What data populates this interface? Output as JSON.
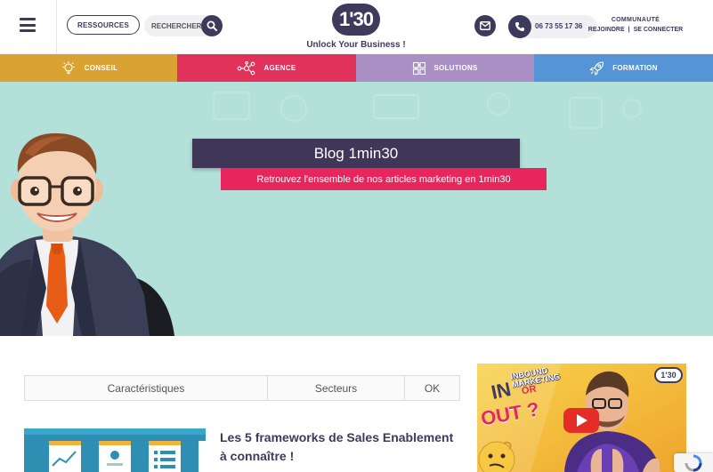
{
  "header": {
    "menu_icon": "hamburger-icon",
    "ressources_label": "RESSOURCES",
    "search_placeholder": "RECHERCHER",
    "search_icon": "magnifier-icon",
    "logo_text": "1'30",
    "logo_tagline": "Unlock Your Business !",
    "mail_icon": "envelope-icon",
    "phone_icon": "phone-icon",
    "phone_number": "06 73 55 17 36",
    "community_title": "COMMUNAUTÉ",
    "join_label": "REJOINDRE",
    "separator": "|",
    "login_label": "SE CONNECTER"
  },
  "nav": {
    "items": [
      {
        "label": "CONSEIL",
        "icon": "lightbulb-icon",
        "color": "#d9a233"
      },
      {
        "label": "AGENCE",
        "icon": "network-icon",
        "color": "#e0325a"
      },
      {
        "label": "SOLUTIONS",
        "icon": "puzzle-icon",
        "color": "#a98fc4"
      },
      {
        "label": "FORMATION",
        "icon": "rocket-icon",
        "color": "#5595d6"
      }
    ]
  },
  "hero": {
    "title": "Blog 1min30",
    "subtitle": "Retrouvez l'ensemble de nos articles marketing en 1min30",
    "background": "#b3e0d9"
  },
  "filters": {
    "items": [
      "Caractéristiques",
      "Secteurs",
      "OK"
    ]
  },
  "article": {
    "title_line1": "Les 5 frameworks de Sales Enablement",
    "title_line2": "à connaître !"
  },
  "video": {
    "badge": "1'30",
    "text_top": "INBOUND MARKETING",
    "text_in": "IN",
    "text_or": "OR",
    "text_out": "OUT ?",
    "play_icon": "youtube-play-icon"
  }
}
